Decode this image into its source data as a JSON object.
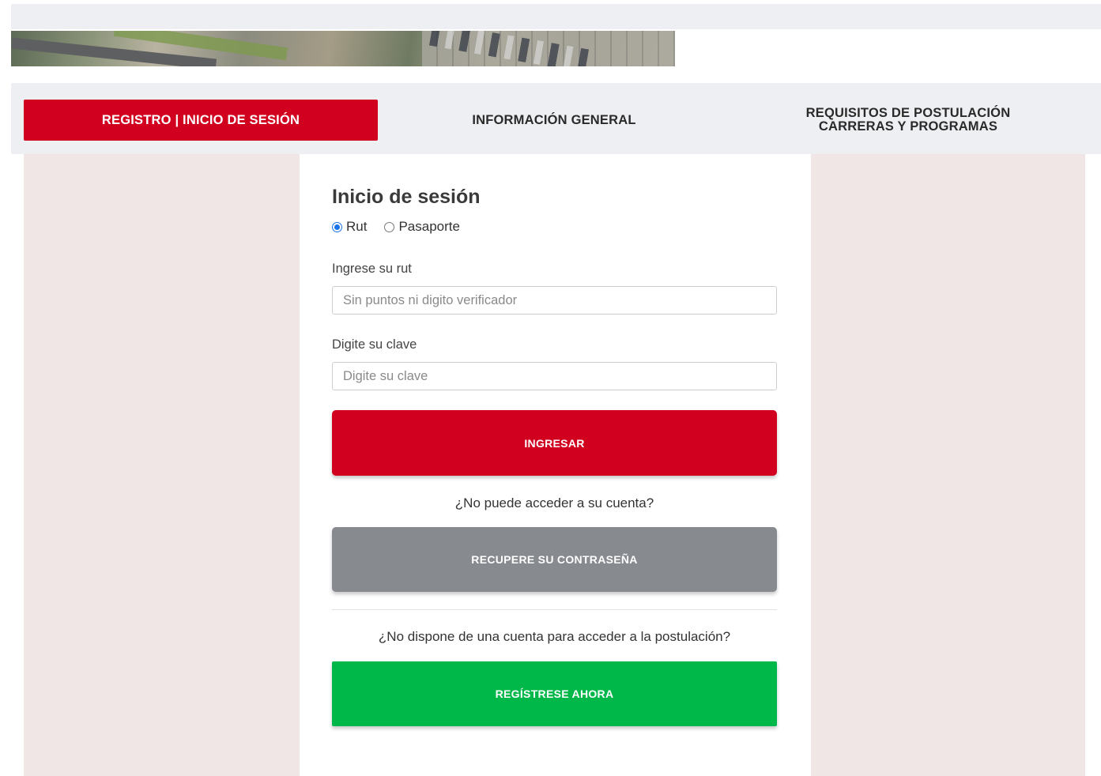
{
  "nav": {
    "tabs": [
      {
        "label": "REGISTRO | INICIO DE SESIÓN",
        "active": true
      },
      {
        "label": "INFORMACIÓN GENERAL",
        "active": false
      },
      {
        "label_line1": "REQUISITOS DE POSTULACIÓN",
        "label_line2": "CARRERAS Y PROGRAMAS",
        "active": false
      }
    ]
  },
  "login": {
    "title": "Inicio de sesión",
    "id_type": {
      "options": [
        "Rut",
        "Pasaporte"
      ],
      "selected": "Rut"
    },
    "rut": {
      "label": "Ingrese su rut",
      "value": "",
      "placeholder": "Sin puntos ni digito verificador"
    },
    "password": {
      "label": "Digite su clave",
      "value": "",
      "placeholder": "Digite su clave"
    },
    "submit_label": "INGRESAR",
    "forgot_question": "¿No puede acceder a su cuenta?",
    "recover_label": "RECUPERE SU CONTRASEÑA",
    "register_question": "¿No dispone de una cuenta para acceder a la postulación?",
    "register_label": "REGÍSTRESE AHORA"
  },
  "colors": {
    "primary_red": "#d2001f",
    "recover_gray": "#878a8e",
    "register_green": "#00b84a",
    "side_panel": "#f0e6e6",
    "nav_bg": "#eeeff2",
    "radio_accent": "#1a73e8"
  }
}
